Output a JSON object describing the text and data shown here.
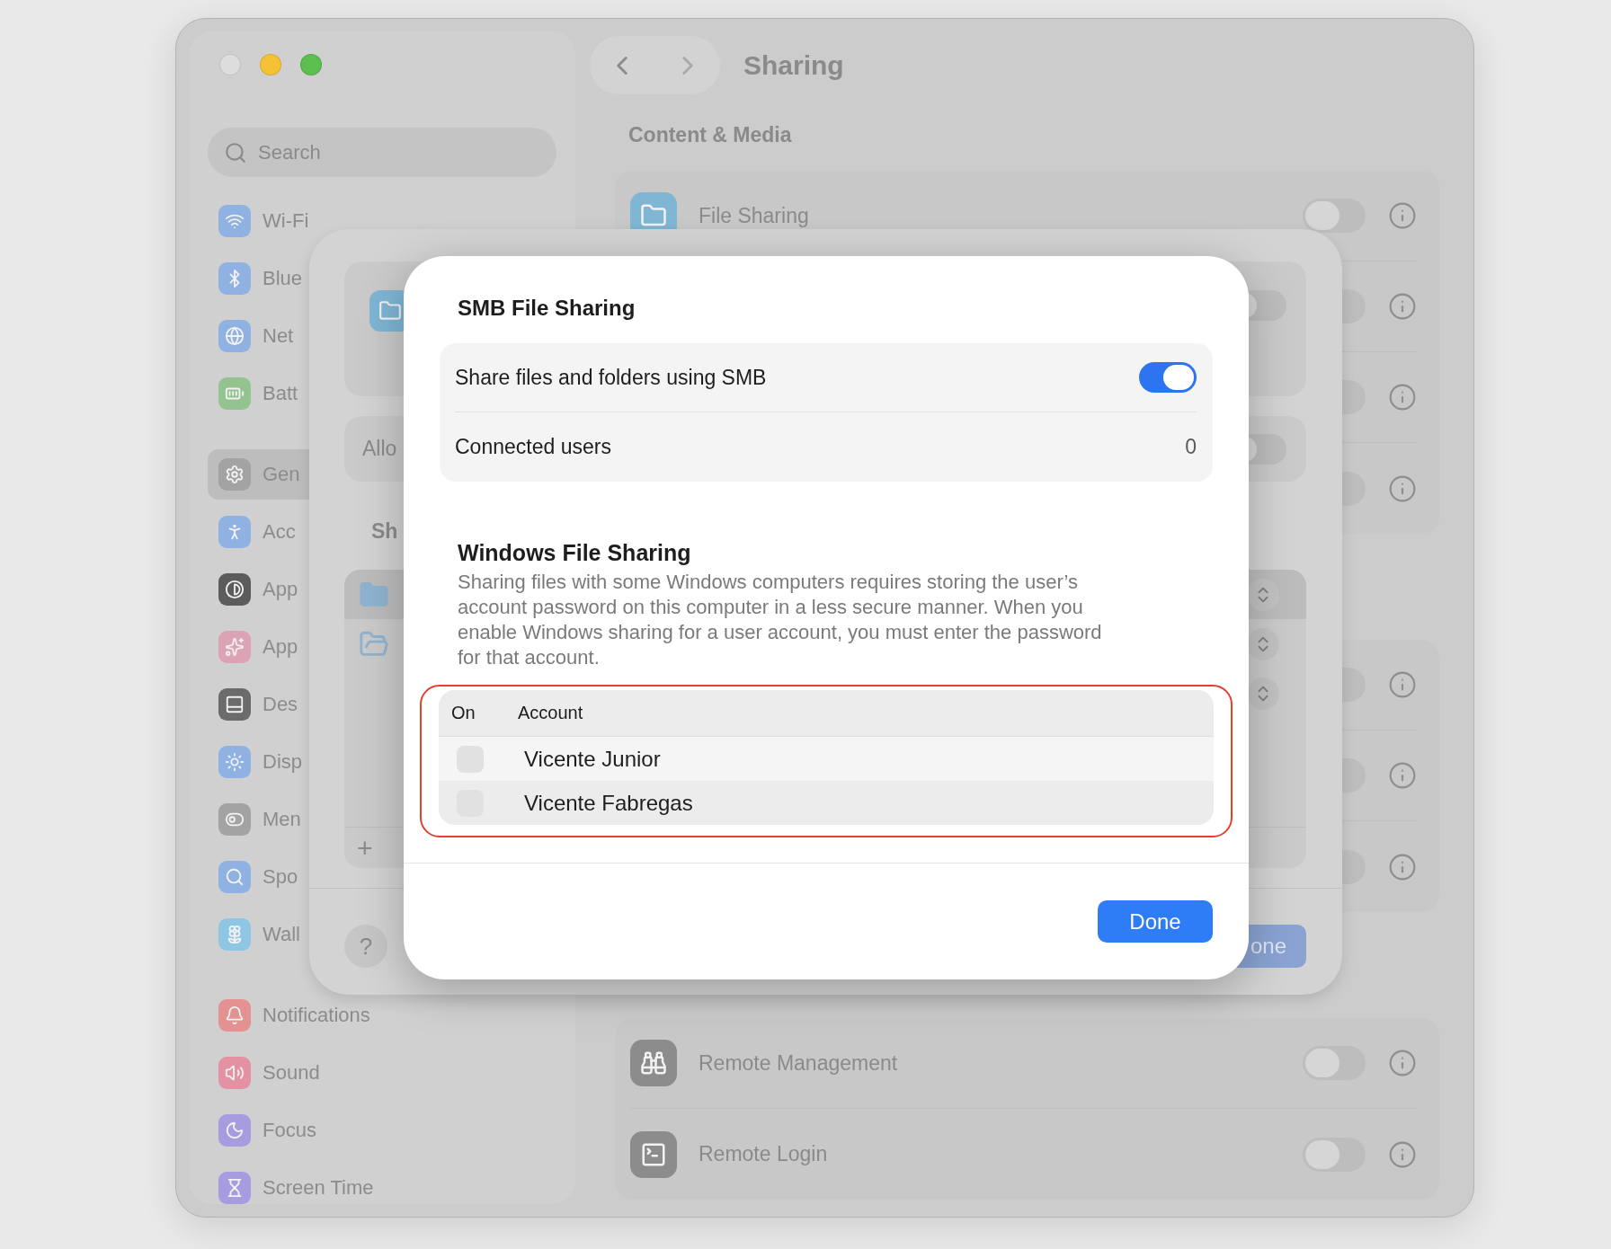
{
  "window": {
    "title": "Sharing"
  },
  "sidebar": {
    "search": {
      "placeholder": "Search"
    },
    "groups": [
      {
        "items": [
          {
            "label": "Wi-Fi",
            "selected": false,
            "color": "#8fb2e3"
          },
          {
            "label": "Blue",
            "selected": false,
            "color": "#8fb2e3"
          },
          {
            "label": "Net",
            "selected": false,
            "color": "#8fb2e3"
          },
          {
            "label": "Batt",
            "selected": false,
            "color": "#93c48f"
          }
        ]
      },
      {
        "items": [
          {
            "label": "Gen",
            "selected": true,
            "color": "#a3a3a3"
          },
          {
            "label": "Acc",
            "selected": false,
            "color": "#8fb2e3"
          },
          {
            "label": "App",
            "selected": false,
            "color": "#5c5c5c"
          },
          {
            "label": "App",
            "selected": false,
            "color": "#dba3b4"
          },
          {
            "label": "Des",
            "selected": false,
            "color": "#6b6b6b"
          },
          {
            "label": "Disp",
            "selected": false,
            "color": "#8fb2e3"
          },
          {
            "label": "Men",
            "selected": false,
            "color": "#a3a3a3"
          },
          {
            "label": "Spo",
            "selected": false,
            "color": "#8fb2e3"
          },
          {
            "label": "Wall",
            "selected": false,
            "color": "#8fc6e3"
          }
        ]
      },
      {
        "items": [
          {
            "label": "Notifications",
            "selected": false,
            "color": "#e39191"
          },
          {
            "label": "Sound",
            "selected": false,
            "color": "#e391a3"
          },
          {
            "label": "Focus",
            "selected": false,
            "color": "#a79ce0"
          },
          {
            "label": "Screen Time",
            "selected": false,
            "color": "#a79ce0"
          }
        ]
      }
    ]
  },
  "content": {
    "section": "Content & Media",
    "cards": [
      {
        "rows": [
          {
            "label": "File Sharing",
            "on": false
          },
          {
            "on": false
          },
          {
            "on": false
          },
          {
            "on": false
          }
        ]
      },
      {
        "rows": [
          {
            "on": false
          },
          {
            "on": false
          },
          {
            "on": false
          }
        ]
      },
      {
        "rows": [
          {
            "label": "Remote Management",
            "on": false
          },
          {
            "label": "Remote Login",
            "on": false
          }
        ]
      }
    ]
  },
  "back_sheet": {
    "main_toggle": {
      "on": false
    },
    "allow": {
      "label": "Allo",
      "on": false
    },
    "shared_heading": "Sh",
    "shared_rows": [
      {
        "kind": "folder",
        "selected": true
      },
      {
        "kind": "public-folder",
        "selected": false
      },
      {
        "kind": "empty",
        "selected": false
      }
    ],
    "add": "+",
    "help": "?",
    "done": "one"
  },
  "dialog": {
    "title": "SMB File Sharing",
    "share": {
      "label": "Share files and folders using SMB",
      "on": true
    },
    "connected": {
      "label": "Connected users",
      "value": "0"
    },
    "windows": {
      "title": "Windows File Sharing",
      "description": "Sharing files with some Windows computers requires storing the user’s account password on this computer in a less secure manner. When you enable Windows sharing for a user account, you must enter the password for that account.",
      "columns": [
        "On",
        "Account"
      ],
      "accounts": [
        {
          "name": "Vicente Junior",
          "checked": false
        },
        {
          "name": "Vicente Fabregas",
          "checked": false
        }
      ]
    },
    "done": "Done"
  }
}
